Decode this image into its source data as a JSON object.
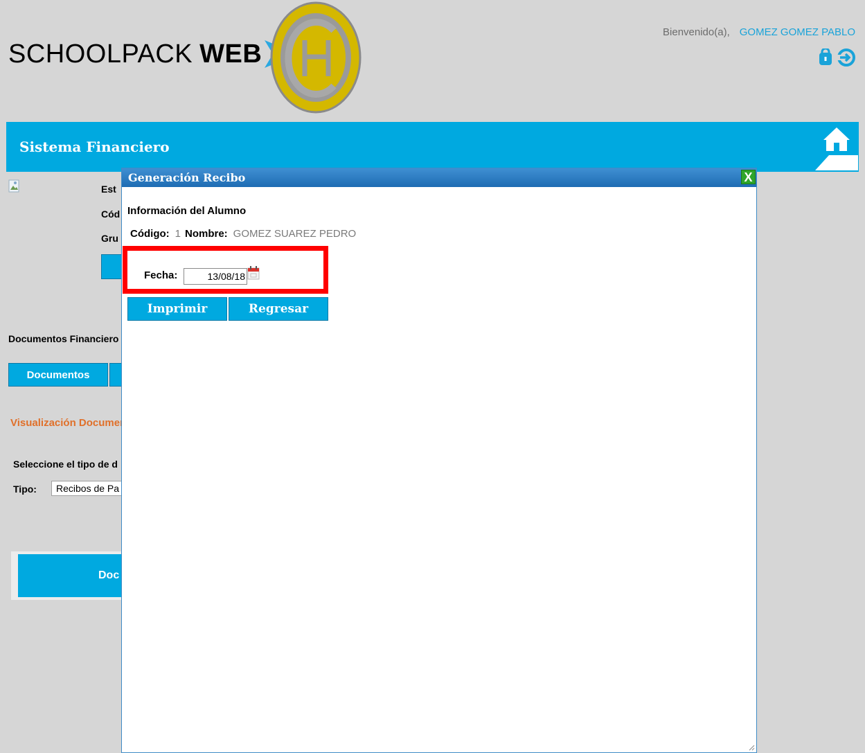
{
  "brand": {
    "part1": "SCHOOLPACK",
    "part2": "WEB"
  },
  "user": {
    "welcome": "Bienvenido(a),",
    "name": "GOMEZ GOMEZ PABLO"
  },
  "topbar": {
    "title": "Sistema Financiero"
  },
  "page": {
    "student_label_1": "Est",
    "student_label_2": "Cód",
    "student_label_3": "Gru",
    "section_title": "Documentos Financiero",
    "tab_documentos": "Documentos",
    "visualization_title": "Visualización Documer",
    "select_prompt": "Seleccione el tipo de d",
    "tipo_label": "Tipo:",
    "tipo_value": "Recibos de Pa",
    "big_button": "Doc"
  },
  "modal": {
    "title": "Generación Recibo",
    "close_label": "X",
    "section": "Información del Alumno",
    "code_label": "Código:",
    "code_value": "1",
    "name_label": "Nombre:",
    "name_value": "GOMEZ SUAREZ PEDRO",
    "date_label": "Fecha:",
    "date_value": "13/08/18",
    "print_button": "Imprimir",
    "back_button": "Regresar"
  },
  "colors": {
    "accent": "#00a9e0",
    "background": "#d6d6d6",
    "highlight": "#ff0000",
    "orange_title": "#e0702a",
    "username": "#1aa3d9"
  }
}
